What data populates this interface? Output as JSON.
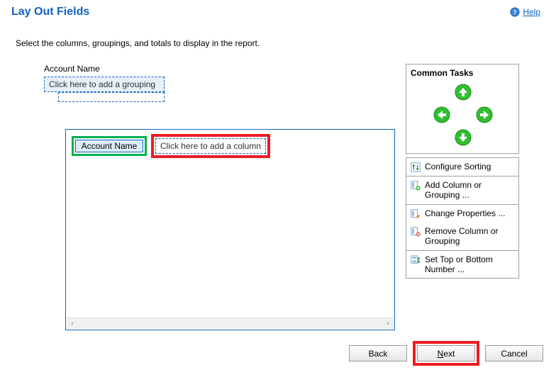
{
  "header": {
    "title": "Lay Out Fields",
    "help_label": "Help"
  },
  "instruction": "Select the columns, groupings, and totals to display in the report.",
  "design": {
    "group_field_label": "Account Name",
    "add_grouping_placeholder": "Click here to add a grouping",
    "column_account": "Account Name",
    "add_column_placeholder": "Click here to add a column"
  },
  "tasks": {
    "title": "Common Tasks",
    "configure_sorting": "Configure Sorting",
    "add_column_grouping": "Add Column or Grouping ...",
    "change_properties": "Change Properties ...",
    "remove_column_grouping": "Remove Column or Grouping",
    "set_top_bottom": "Set Top or Bottom Number ..."
  },
  "footer": {
    "back": "Back",
    "next_prefix": "N",
    "next_rest": "ext",
    "cancel": "Cancel"
  }
}
